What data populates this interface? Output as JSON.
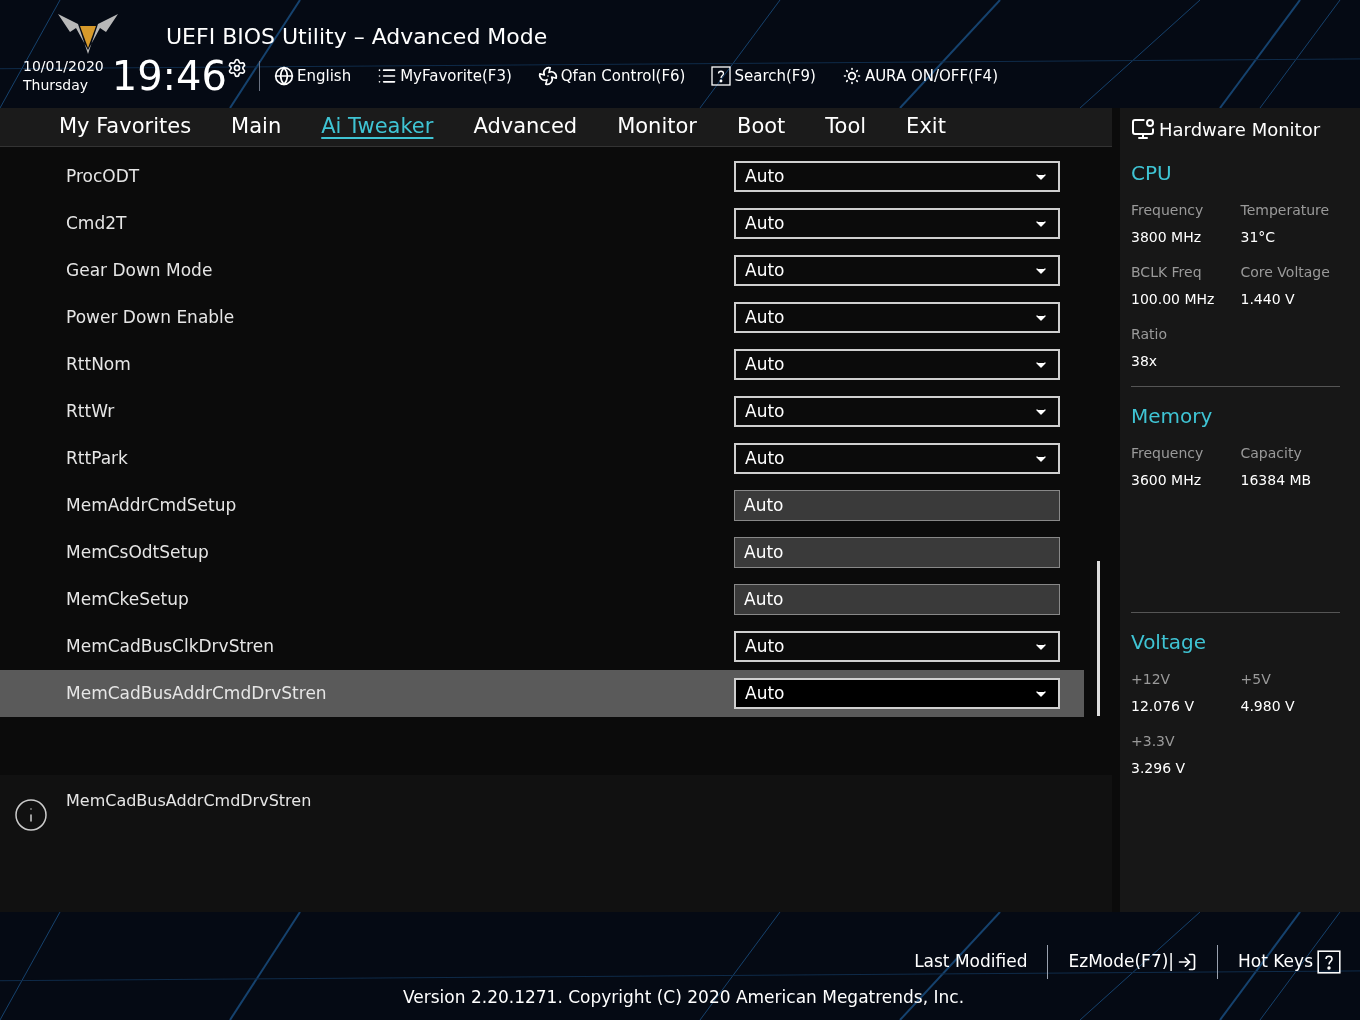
{
  "header": {
    "title": "UEFI BIOS Utility – Advanced Mode",
    "date": "10/01/2020",
    "day": "Thursday",
    "time": "19:46",
    "tools": [
      {
        "kind": "globe",
        "label": "English"
      },
      {
        "kind": "favorite",
        "label": "MyFavorite(F3)"
      },
      {
        "kind": "fan",
        "label": "Qfan Control(F6)"
      },
      {
        "kind": "search",
        "label": "Search(F9)"
      },
      {
        "kind": "aura",
        "label": "AURA ON/OFF(F4)"
      }
    ]
  },
  "tabs": [
    {
      "label": "My Favorites",
      "selected": false
    },
    {
      "label": "Main",
      "selected": false
    },
    {
      "label": "Ai Tweaker",
      "selected": true
    },
    {
      "label": "Advanced",
      "selected": false
    },
    {
      "label": "Monitor",
      "selected": false
    },
    {
      "label": "Boot",
      "selected": false
    },
    {
      "label": "Tool",
      "selected": false
    },
    {
      "label": "Exit",
      "selected": false
    }
  ],
  "settings": [
    {
      "name": "ProcODT",
      "value": "Auto",
      "kind": "dropdown",
      "selected": false
    },
    {
      "name": "Cmd2T",
      "value": "Auto",
      "kind": "dropdown",
      "selected": false
    },
    {
      "name": "Gear Down Mode",
      "value": "Auto",
      "kind": "dropdown",
      "selected": false
    },
    {
      "name": "Power Down Enable",
      "value": "Auto",
      "kind": "dropdown",
      "selected": false
    },
    {
      "name": "RttNom",
      "value": "Auto",
      "kind": "dropdown",
      "selected": false
    },
    {
      "name": "RttWr",
      "value": "Auto",
      "kind": "dropdown",
      "selected": false
    },
    {
      "name": "RttPark",
      "value": "Auto",
      "kind": "dropdown",
      "selected": false
    },
    {
      "name": "MemAddrCmdSetup",
      "value": "Auto",
      "kind": "readonly",
      "selected": false
    },
    {
      "name": "MemCsOdtSetup",
      "value": "Auto",
      "kind": "readonly",
      "selected": false
    },
    {
      "name": "MemCkeSetup",
      "value": "Auto",
      "kind": "readonly",
      "selected": false
    },
    {
      "name": "MemCadBusClkDrvStren",
      "value": "Auto",
      "kind": "dropdown",
      "selected": false
    },
    {
      "name": "MemCadBusAddrCmdDrvStren",
      "value": "Auto",
      "kind": "dropdown",
      "selected": true
    }
  ],
  "help": {
    "text": "MemCadBusAddrCmdDrvStren"
  },
  "hardware_monitor": {
    "title": "Hardware Monitor",
    "sections": [
      {
        "title": "CPU",
        "items": [
          {
            "label": "Frequency",
            "value": "3800 MHz"
          },
          {
            "label": "Temperature",
            "value": "31°C"
          },
          {
            "label": "BCLK Freq",
            "value": "100.00 MHz"
          },
          {
            "label": "Core Voltage",
            "value": "1.440 V"
          },
          {
            "label": "Ratio",
            "value": "38x"
          }
        ]
      },
      {
        "title": "Memory",
        "items": [
          {
            "label": "Frequency",
            "value": "3600 MHz"
          },
          {
            "label": "Capacity",
            "value": "16384 MB"
          }
        ]
      },
      {
        "title": "Voltage",
        "items": [
          {
            "label": "+12V",
            "value": "12.076 V"
          },
          {
            "label": "+5V",
            "value": "4.980 V"
          },
          {
            "label": "+3.3V",
            "value": "3.296 V"
          }
        ]
      }
    ]
  },
  "footer": {
    "actions": [
      {
        "kind": "text",
        "label": "Last Modified"
      },
      {
        "kind": "exit",
        "label": "EzMode(F7)|"
      },
      {
        "kind": "help",
        "label": "Hot Keys"
      }
    ],
    "version": "Version 2.20.1271. Copyright (C) 2020 American Megatrends, Inc."
  }
}
